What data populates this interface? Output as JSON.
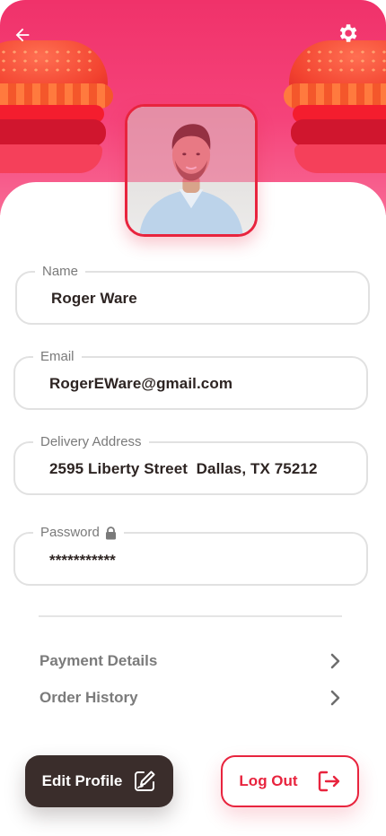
{
  "header": {
    "back_icon": "arrow-left-icon",
    "settings_icon": "gear-icon",
    "background_color": "#f0326a"
  },
  "profile": {
    "avatar_alt": "avatar"
  },
  "fields": {
    "name": {
      "label": "Name",
      "value": "Roger Ware"
    },
    "email": {
      "label": "Email",
      "value": "RogerEWare@gmail.com"
    },
    "address": {
      "label": "Delivery Address",
      "value": "2595 Liberty Street  Dallas, TX 75212"
    },
    "password": {
      "label": "Password",
      "value": "***********",
      "icon": "lock-icon"
    }
  },
  "menu": {
    "payment": {
      "label": "Payment Details",
      "icon": "chevron-right-icon"
    },
    "orders": {
      "label": "Order History",
      "icon": "chevron-right-icon"
    }
  },
  "actions": {
    "edit_label": "Edit Profile",
    "edit_icon": "edit-icon",
    "logout_label": "Log Out",
    "logout_icon": "logout-icon"
  },
  "colors": {
    "accent": "#e8243e",
    "dark": "#3a2d2b",
    "muted": "#7b7b7b"
  }
}
